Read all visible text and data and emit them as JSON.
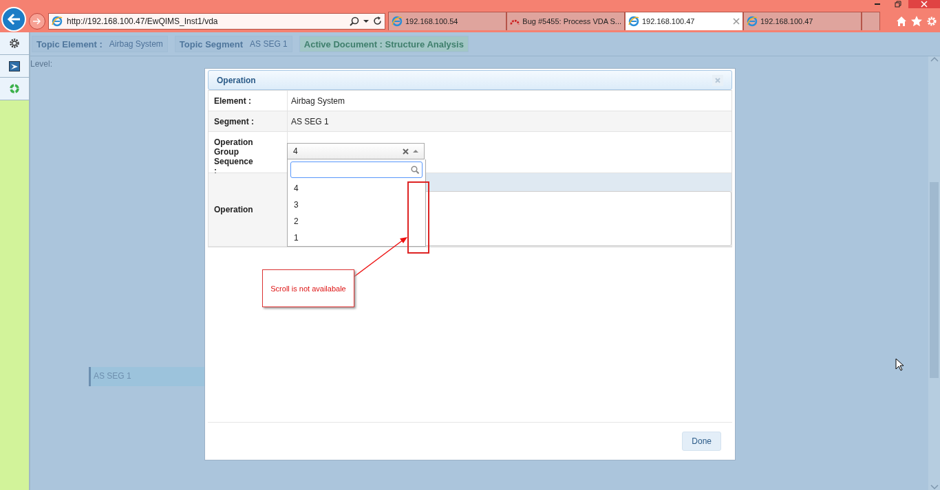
{
  "browser": {
    "address": "http://192.168.100.47/EwQIMS_Inst1/vda",
    "tabs": [
      {
        "title": "192.168.100.54",
        "kind": "ie",
        "selected": false,
        "closable": false
      },
      {
        "title": "Bug #5455: Process VDA S...",
        "kind": "bug",
        "selected": false,
        "closable": false
      },
      {
        "title": "192.168.100.47",
        "kind": "ie",
        "selected": true,
        "closable": true
      },
      {
        "title": "192.168.100.47",
        "kind": "ie",
        "selected": false,
        "closable": false
      }
    ]
  },
  "header": {
    "chips": [
      {
        "label": "Topic Element :",
        "value": "Airbag System",
        "kind": "plain"
      },
      {
        "label": "Topic Segment",
        "value": "AS SEG 1",
        "kind": "plain"
      },
      {
        "label": "Active Document : Structure Analysis",
        "kind": "active"
      }
    ]
  },
  "level_label": "Level:",
  "background_item": "AS SEG 1",
  "dialog": {
    "title": "Operation",
    "rows": [
      {
        "label": "Element :",
        "value": "Airbag System",
        "kind": "text"
      },
      {
        "label": "Segment :",
        "value": "AS SEG 1",
        "kind": "text"
      },
      {
        "label": "Operation Group Sequence :",
        "kind": "select",
        "value": "4",
        "expanded": true,
        "options": [
          "4",
          "3",
          "2",
          "1"
        ]
      },
      {
        "label": "Operation",
        "kind": "textarea"
      }
    ],
    "done": "Done"
  },
  "annotation": {
    "text": "Scroll is not availabale"
  }
}
